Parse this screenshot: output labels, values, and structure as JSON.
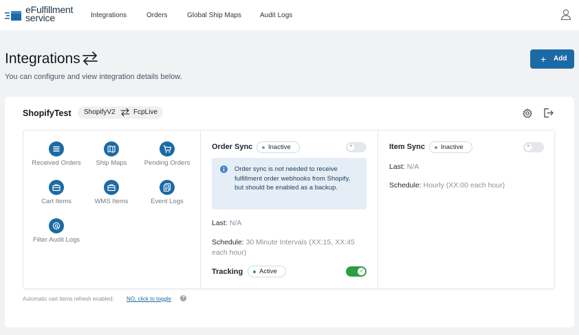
{
  "brand": {
    "line1": "eFulfillment",
    "line2": "service"
  },
  "nav": [
    "Integrations",
    "Orders",
    "Global Ship Maps",
    "Audit Logs"
  ],
  "page": {
    "title": "Integrations",
    "subtitle": "You can configure and view integration details below.",
    "add_label": "Add"
  },
  "integration": {
    "name": "ShopifyTest",
    "source": "ShopifyV2",
    "target": "FcpLive"
  },
  "tiles": [
    {
      "label": "Received Orders",
      "icon": "list-icon"
    },
    {
      "label": "Ship Maps",
      "icon": "map-icon"
    },
    {
      "label": "Pending Orders",
      "icon": "cart-icon"
    },
    {
      "label": "Cart Items",
      "icon": "briefcase-icon"
    },
    {
      "label": "WMS Items",
      "icon": "briefcase-icon"
    },
    {
      "label": "Event Logs",
      "icon": "documents-icon"
    },
    {
      "label": "Filter Audit Logs",
      "icon": "search-icon"
    }
  ],
  "order_sync": {
    "title": "Order Sync",
    "status": "Inactive",
    "enabled": false,
    "info": "Order sync is not needed to receive fulfillment order webhooks from Shopify, but should be enabled as a backup.",
    "last_label": "Last:",
    "last_value": "N/A",
    "schedule_label": "Schedule:",
    "schedule_value": "30 Minute Intervals (XX:15, XX:45 each hour)"
  },
  "tracking": {
    "title": "Tracking",
    "status": "Active",
    "enabled": true
  },
  "item_sync": {
    "title": "Item Sync",
    "status": "Inactive",
    "enabled": false,
    "last_label": "Last:",
    "last_value": "N/A",
    "schedule_label": "Schedule:",
    "schedule_value": "Hourly (XX:00 each hour)"
  },
  "footer": {
    "note": "Automatic cart items refresh enabled:",
    "link": "NO, click to toggle",
    "help": "?"
  },
  "colors": {
    "accent": "#1b6aa5",
    "active_green": "#2e9e44",
    "inactive_dot": "#8b929a"
  }
}
